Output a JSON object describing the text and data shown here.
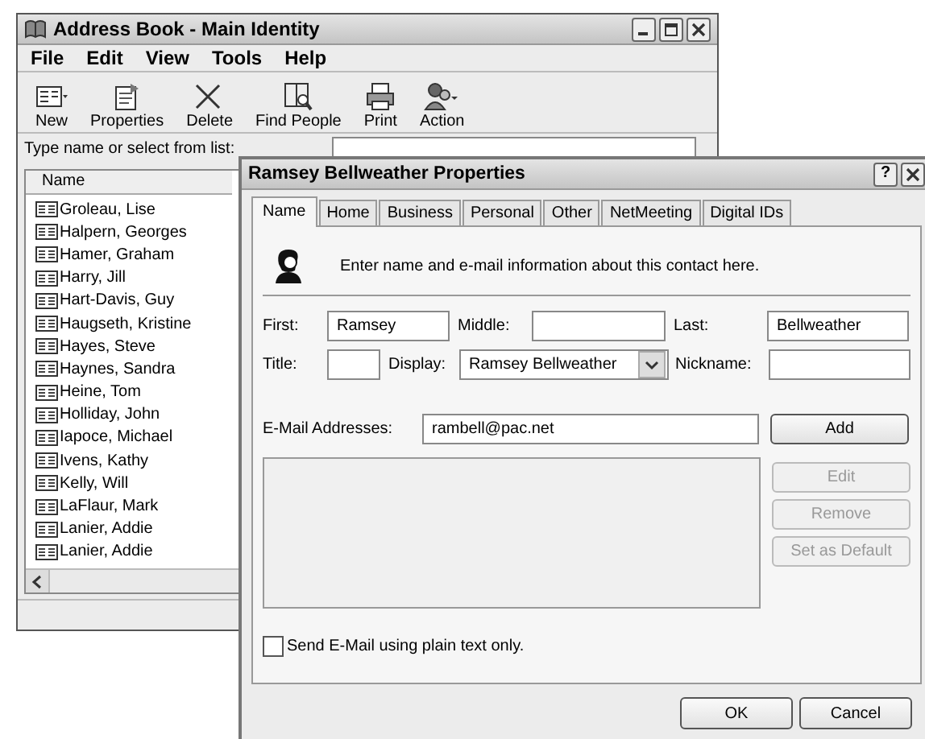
{
  "address_book": {
    "title": "Address Book - Main Identity",
    "menu": [
      "File",
      "Edit",
      "View",
      "Tools",
      "Help"
    ],
    "toolbar": [
      {
        "label": "New",
        "kind": "card",
        "dropdown": true
      },
      {
        "label": "Properties",
        "kind": "properties",
        "dropdown": false
      },
      {
        "label": "Delete",
        "kind": "delete",
        "dropdown": false
      },
      {
        "label": "Find People",
        "kind": "find",
        "dropdown": false
      },
      {
        "label": "Print",
        "kind": "print",
        "dropdown": false
      },
      {
        "label": "Action",
        "kind": "action",
        "dropdown": true
      }
    ],
    "search": {
      "label": "Type name or select from list:"
    },
    "list": {
      "column": "Name",
      "rows": [
        "Groleau, Lise",
        "Halpern, Georges",
        "Hamer, Graham",
        "Harry, Jill",
        "Hart-Davis, Guy",
        "Haugseth, Kristine",
        "Hayes, Steve",
        "Haynes, Sandra",
        "Heine, Tom",
        "Holliday, John",
        "Iapoce, Michael",
        "Ivens, Kathy",
        "Kelly, Will",
        "LaFlaur, Mark",
        "Lanier, Addie",
        "Lanier, Addie"
      ]
    }
  },
  "dialog": {
    "title": "Ramsey Bellweather Properties",
    "help_button": "?",
    "tabs": [
      {
        "label": "Name",
        "selected": true
      },
      {
        "label": "Home",
        "selected": false
      },
      {
        "label": "Business",
        "selected": false
      },
      {
        "label": "Personal",
        "selected": false
      },
      {
        "label": "Other",
        "selected": false
      },
      {
        "label": "NetMeeting",
        "selected": false
      },
      {
        "label": "Digital IDs",
        "selected": false
      }
    ],
    "intro": "Enter name and e-mail information about this contact here.",
    "name_rows": [
      [
        {
          "label": "First:",
          "kind": "text",
          "value": "Ramsey"
        },
        {
          "label": "Middle:",
          "kind": "text"
        },
        {
          "label": "Last:",
          "kind": "text",
          "value": "Bellweather"
        }
      ],
      [
        {
          "label": "Title:",
          "kind": "text"
        },
        {
          "label": "Display:",
          "kind": "select",
          "value": "Ramsey Bellweather"
        },
        {
          "label": "Nickname:",
          "kind": "text"
        }
      ]
    ],
    "email": {
      "label": "E-Mail Addresses:",
      "value": "rambell@pac.net"
    },
    "email_buttons": [
      {
        "label": "Add",
        "disabled": false
      },
      {
        "label": "Edit",
        "disabled": true
      },
      {
        "label": "Remove",
        "disabled": true
      },
      {
        "label": "Set as Default",
        "disabled": true
      }
    ],
    "plain_text": {
      "label": "Send E-Mail using plain text only.",
      "checked": false
    },
    "footer_buttons": [
      "OK",
      "Cancel"
    ]
  }
}
